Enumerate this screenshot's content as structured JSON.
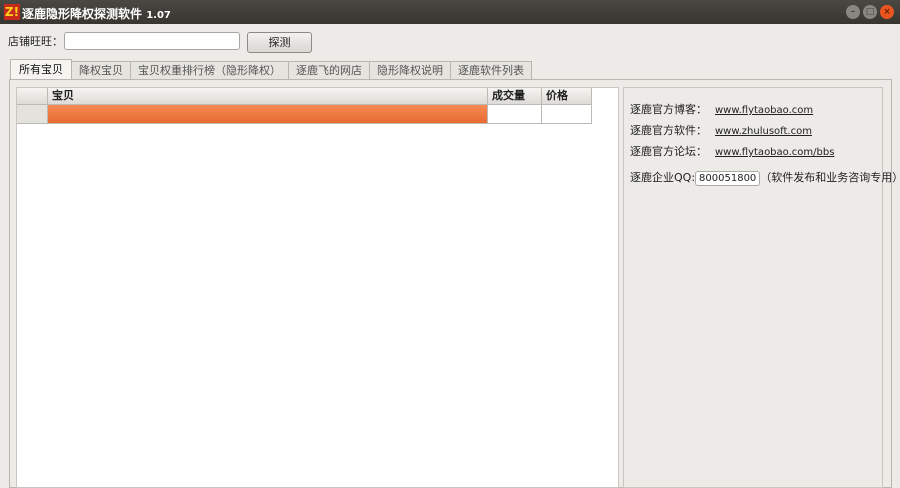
{
  "window": {
    "title": "逐鹿隐形降权探测软件",
    "version": "1.07",
    "logo": "Z!"
  },
  "search": {
    "label": "店铺旺旺：",
    "value": "",
    "button": "探测"
  },
  "tabs": [
    "所有宝贝",
    "降权宝贝",
    "宝贝权重排行榜（隐形降权）",
    "逐鹿飞的网店",
    "隐形降权说明",
    "逐鹿软件列表"
  ],
  "table": {
    "columns": [
      "",
      "宝贝",
      "成交量",
      "价格"
    ],
    "rows": [
      [
        "",
        "",
        "",
        ""
      ]
    ]
  },
  "info": {
    "links": [
      {
        "label": "逐鹿官方博客：",
        "url": "www.flytaobao.com"
      },
      {
        "label": "逐鹿官方软件：",
        "url": "www.zhulusoft.com"
      },
      {
        "label": "逐鹿官方论坛：",
        "url": "www.flytaobao.com/bbs"
      }
    ],
    "qq_label": "逐鹿企业QQ:",
    "qq": "800051800",
    "qq_note": "（软件发布和业务咨询专用）"
  }
}
